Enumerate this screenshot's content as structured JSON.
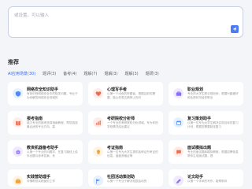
{
  "input": {
    "placeholder": "或设置。可以输入"
  },
  "section": {
    "title": "推荐"
  },
  "tabs": [
    {
      "label": "AI应用场景(30)"
    },
    {
      "label": "题评(3)"
    },
    {
      "label": "备考(4)"
    },
    {
      "label": "题解(7)"
    },
    {
      "label": "题解(3)"
    },
    {
      "label": "题解(3)"
    },
    {
      "label": "题研(3)"
    }
  ],
  "cards": [
    {
      "title": "网络安全知识助手",
      "desc": "有效识别网络安全中的相关问题，专业于为你解答网络安全领域的",
      "icon": "shield-icon",
      "color": "#4d8cf5",
      "bg": "#e7f0ff"
    },
    {
      "title": "心理写手者",
      "desc": "以第一个出色的听题者，根据目前的需要，能让你表达精神上的问",
      "icon": "heart-icon",
      "color": "#ef6a4e",
      "bg": "#fdece8"
    },
    {
      "title": "职业规划",
      "desc": "专业的大学生职业规划师，根据兴趣爱好和业绩状况给你职业",
      "icon": "briefcase-icon",
      "color": "#8a6ef3",
      "bg": "#efeafe"
    },
    {
      "title": "报考指南",
      "desc": "能力专业的报考选择指南教程，帮您挑选最合适的专业方向，高",
      "icon": "book-icon",
      "color": "#ef6a4e",
      "bg": "#fdece8"
    },
    {
      "title": "考研院校分析师",
      "desc": "一个专业的考研院校分析领域，专为你的学校情况给出建议",
      "icon": "chart-icon",
      "color": "#ef6a4e",
      "bg": "#fdece8"
    },
    {
      "title": "复习策划助手",
      "desc": "以第一位专为大学生解决实现目标的复习计划，根据您需要制定复习",
      "icon": "calendar-icon",
      "color": "#4d8cf5",
      "bg": "#e7f0ff"
    },
    {
      "title": "教资机器备考助手",
      "desc": "以第一个专业的问题学，在复习路线上给你出题与参考答案，系",
      "icon": "robot-icon",
      "color": "#8a6ef3",
      "bg": "#efeafe"
    },
    {
      "title": "考证指南",
      "desc": "以第一位专为大学生提供各种证书考证的信息，涵盖资格证等",
      "icon": "certificate-icon",
      "color": "#f2a23a",
      "bg": "#fef4e4"
    },
    {
      "title": "面试模拟出题",
      "desc": "专业的面试题库模拟教程，根据招聘信息帮你生成面试题，提",
      "icon": "chat-icon",
      "color": "#ef6a4e",
      "bg": "#fdece8"
    },
    {
      "title": "实践营助理手",
      "desc": "详情帮您实践营的工作",
      "icon": "briefcase-icon",
      "color": "#f2a23a",
      "bg": "#fef4e4"
    },
    {
      "title": "社团活动策划助",
      "desc": "以第一个专业于解决校园活动的",
      "icon": "flag-icon",
      "color": "#4d8cf5",
      "bg": "#e7f0ff"
    },
    {
      "title": "论文助手",
      "desc": "以第一个学术的写作，能帮助你",
      "icon": "pen-icon",
      "color": "#8a6ef3",
      "bg": "#efeafe"
    }
  ]
}
